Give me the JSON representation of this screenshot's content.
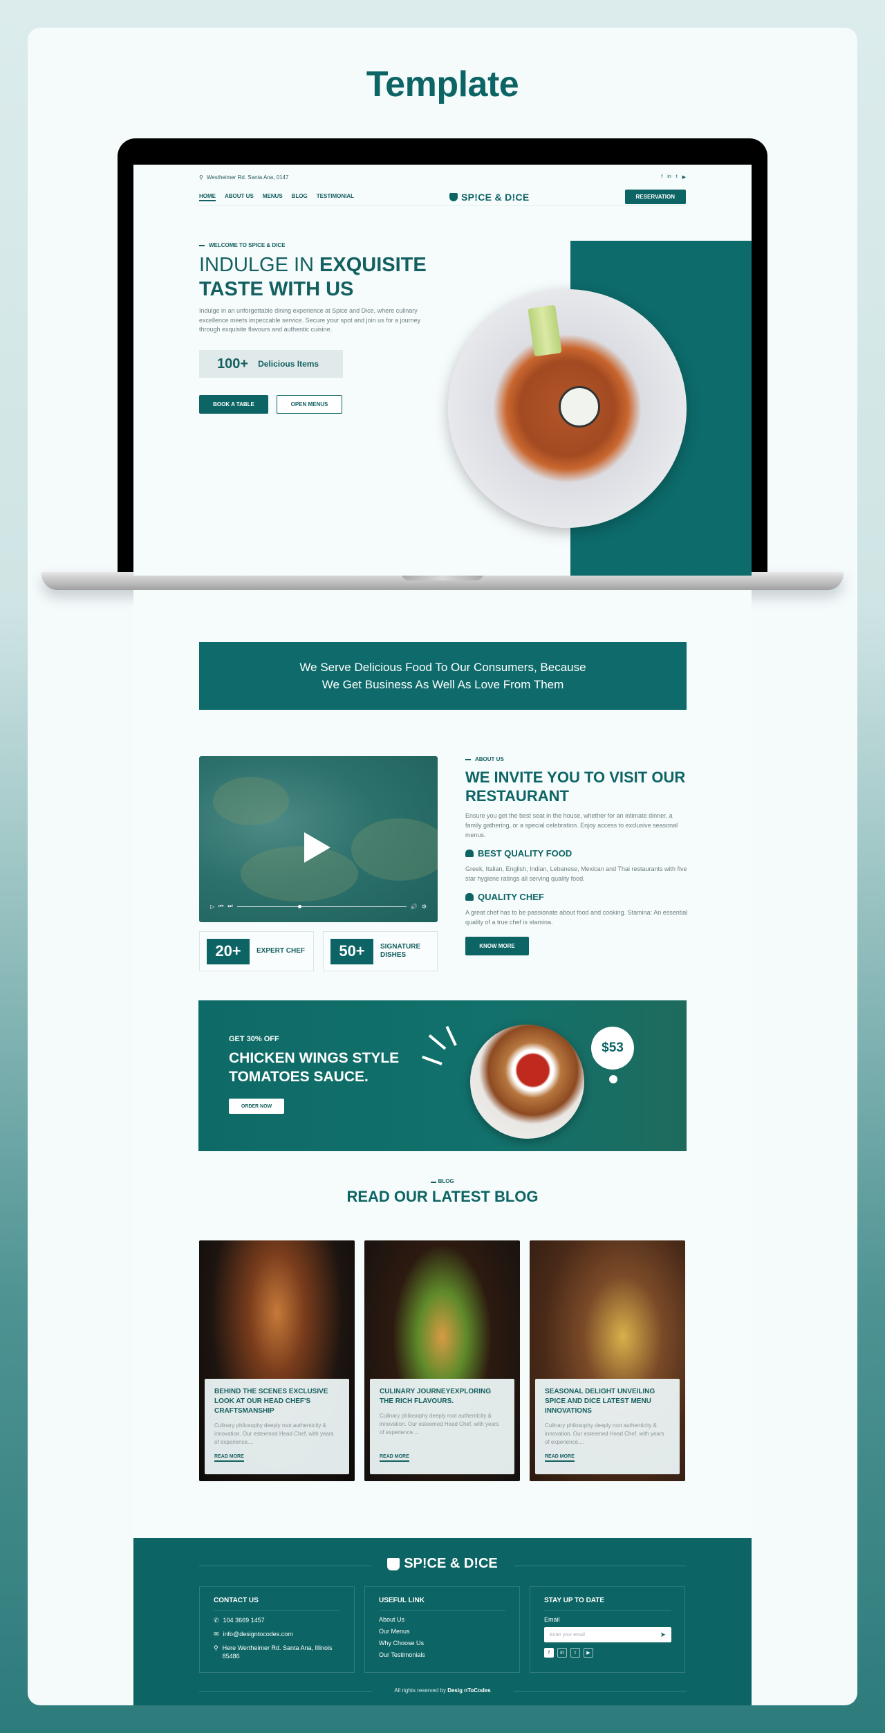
{
  "page_title": "Template",
  "header": {
    "address": "Westheimer Rd. Santa Ana, 0147",
    "social_icons": [
      "facebook-icon",
      "linkedin-icon",
      "twitter-icon",
      "youtube-icon"
    ],
    "social_glyphs": [
      "f",
      "in",
      "t",
      "▶"
    ],
    "nav": [
      "HOME",
      "ABOUT US",
      "MENUS",
      "BLOG",
      "TESTIMONIAL"
    ],
    "active_nav": "HOME",
    "logo": "SP!CE & D!CE",
    "reservation": "RESERVATION"
  },
  "hero": {
    "tag": "WELCOME TO SPICE & DICE",
    "title_light": "INDULGE IN ",
    "title_bold_1": "EXQUISITE",
    "title_bold_2": "TASTE WITH US",
    "description": "Indulge in an unforgettable dining experience at Spice and Dice, where culinary excellence meets impeccable service. Secure your spot and join us for a journey through exquisite flavours and authentic cuisine.",
    "items_count": "100+",
    "items_label": "Delicious Items",
    "book_btn": "BOOK A TABLE",
    "menu_btn": "OPEN MENUS"
  },
  "banner": {
    "line1": "We Serve Delicious Food To Our Consumers, Because",
    "line2": "We Get Business As Well As Love From Them"
  },
  "video": {
    "progress": 0.36
  },
  "stats": [
    {
      "value": "20+",
      "label": "EXPERT CHEF"
    },
    {
      "value": "50+",
      "label": "SIGNATURE DISHES"
    }
  ],
  "about": {
    "tag": "ABOUT US",
    "title": "WE INVITE YOU TO VISIT OUR RESTAURANT",
    "description": "Ensure you get the best seat in the house, whether for an intimate dinner, a family gathering, or a special celebration. Enjoy access to exclusive seasonal menus.",
    "features": [
      {
        "title": "BEST QUALITY FOOD",
        "text": "Greek, Italian, English, Indian, Lebanese, Mexican and Thai restaurants with five star hygiene ratings all serving quality food."
      },
      {
        "title": "QUALITY CHEF",
        "text": "A great chef has to be passionate about food and cooking. Stamina: An essential quality of a true chef is stamina."
      }
    ],
    "button": "KNOW MORE"
  },
  "promo": {
    "discount": "GET 30% OFF",
    "title": "CHICKEN WINGS STYLE TOMATOES SAUCE.",
    "button": "ORDER NOW",
    "price": "$53"
  },
  "blog": {
    "tag": "BLOG",
    "title": "READ OUR LATEST BLOG",
    "posts": [
      {
        "title": "BEHIND THE SCENES EXCLUSIVE LOOK AT OUR HEAD CHEF'S CRAFTSMANSHIP",
        "excerpt": "Culinary philosophy deeply root authenticity & innovation. Our esteemed Head Chef, with years of experience....",
        "link": "READ MORE"
      },
      {
        "title": "CULINARY JOURNEYEXPLORING THE RICH FLAVOURS.",
        "excerpt": "Culinary philosophy deeply root authenticity & innovation. Our esteemed Head Chef, with years of experience....",
        "link": "READ MORE"
      },
      {
        "title": "SEASONAL DELIGHT UNVEILING SPICE AND DICE LATEST MENU INNOVATIONS",
        "excerpt": "Culinary philosophy deeply root authenticity & innovation. Our esteemed Head Chef, with years of experience....",
        "link": "READ MORE"
      }
    ]
  },
  "footer": {
    "logo": "SP!CE & D!CE",
    "contact": {
      "title": "CONTACT US",
      "phone": "104 3669 1457",
      "email": "info@designtocodes.com",
      "address": "Here Wertheimer Rd. Santa Ana, Illinois 85486"
    },
    "links": {
      "title": "USEFUL LINK",
      "items": [
        "About Us",
        "Our Menus",
        "Why Choose Us",
        "Our Testimonials"
      ]
    },
    "newsletter": {
      "title": "STAY UP TO DATE",
      "label": "Email",
      "placeholder": "Enter your email"
    },
    "copyright_prefix": "All rights reserved by ",
    "copyright_brand": "Desig nToCodes"
  },
  "colors": {
    "brand": "#0d6464",
    "brand_light": "#e1eaeb"
  }
}
